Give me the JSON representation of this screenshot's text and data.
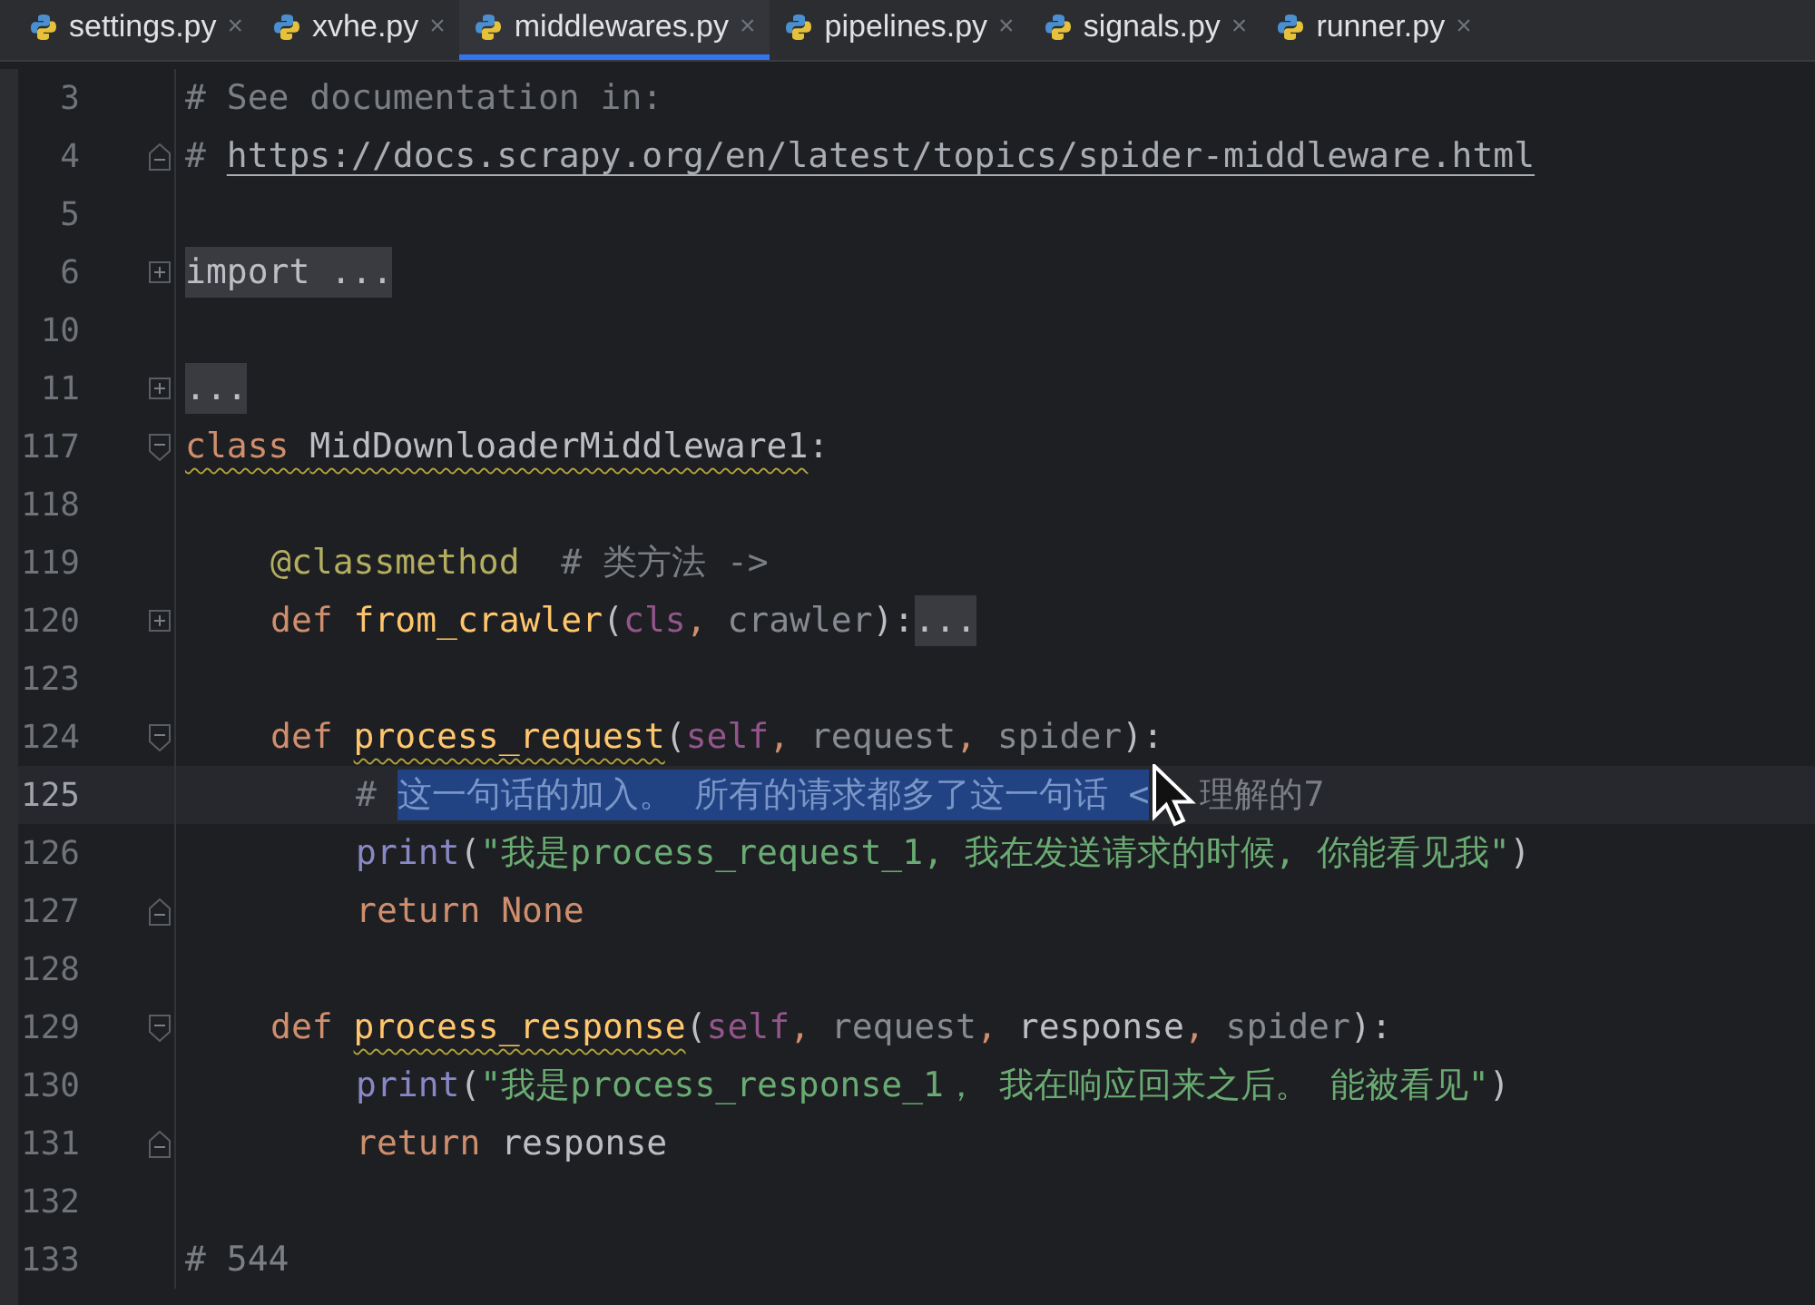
{
  "tabs": [
    {
      "label": "settings.py",
      "selected": false,
      "close": "×"
    },
    {
      "label": "xvhe.py",
      "selected": false,
      "close": "×"
    },
    {
      "label": "middlewares.py",
      "selected": true,
      "close": "×"
    },
    {
      "label": "pipelines.py",
      "selected": false,
      "close": "×"
    },
    {
      "label": "signals.py",
      "selected": false,
      "close": "×"
    },
    {
      "label": "runner.py",
      "selected": false,
      "close": "×"
    }
  ],
  "lines": [
    {
      "number": "3",
      "kind": "plain",
      "current": false,
      "tokens": [
        {
          "kind": "comment",
          "text": "# See documentation in:"
        }
      ]
    },
    {
      "number": "4",
      "kind": "end",
      "current": false,
      "tokens": [
        {
          "kind": "comment",
          "text": "# "
        },
        {
          "kind": "link",
          "text": "https://docs.scrapy.org/en/latest/topics/spider-middleware.html"
        }
      ]
    },
    {
      "number": "5",
      "kind": "plain",
      "current": false
    },
    {
      "number": "6",
      "kind": "expand",
      "current": false,
      "tokens": [
        {
          "kind": "folded",
          "text": "import ..."
        }
      ]
    },
    {
      "number": "10",
      "kind": "plain",
      "current": false
    },
    {
      "number": "11",
      "kind": "expand",
      "current": false,
      "tokens": [
        {
          "kind": "folded",
          "text": "..."
        }
      ]
    },
    {
      "number": "117",
      "kind": "collapse",
      "current": false,
      "tokens": [
        {
          "kind": "keyword",
          "text": "class ",
          "squiggle": true
        },
        {
          "kind": "plain",
          "text": "MidDownloaderMiddleware1",
          "squiggle": true
        },
        {
          "kind": "plain",
          "text": ":"
        }
      ],
      "children": [
        {
          "number": "118",
          "kind": "plain",
          "current": false
        },
        {
          "number": "119",
          "kind": "plain",
          "current": false,
          "tokens": [
            {
              "kind": "decorator",
              "text": "@classmethod"
            },
            {
              "kind": "comment",
              "text": "  # 类方法 ->"
            }
          ]
        },
        {
          "number": "120",
          "kind": "expand",
          "current": false,
          "tokens": [
            {
              "kind": "keyword",
              "text": "def "
            },
            {
              "kind": "function",
              "text": "from_crawler"
            },
            {
              "kind": "plain",
              "text": "("
            },
            {
              "kind": "self",
              "text": "cls"
            },
            {
              "kind": "keyword",
              "text": ", "
            },
            {
              "kind": "unused",
              "text": "crawler"
            },
            {
              "kind": "plain",
              "text": "):"
            },
            {
              "kind": "folded",
              "text": "..."
            }
          ]
        },
        {
          "number": "123",
          "kind": "plain",
          "current": false
        },
        {
          "number": "124",
          "kind": "collapse",
          "current": false,
          "tokens": [
            {
              "kind": "keyword",
              "text": "def "
            },
            {
              "kind": "function",
              "text": "process_request",
              "squiggle": true
            },
            {
              "kind": "plain",
              "text": "("
            },
            {
              "kind": "self",
              "text": "self"
            },
            {
              "kind": "keyword",
              "text": ", "
            },
            {
              "kind": "unused",
              "text": "request"
            },
            {
              "kind": "keyword",
              "text": ", "
            },
            {
              "kind": "unused",
              "text": "spider"
            },
            {
              "kind": "plain",
              "text": "):"
            }
          ],
          "children": [
            {
              "number": "125",
              "kind": "plain",
              "current": true,
              "tokens": [
                {
                  "kind": "comment",
                  "text": "# "
                },
                {
                  "kind": "selected",
                  "text": "这一句话的加入。 所有的请求都多了这一句话 <"
                },
                {
                  "kind": "comment",
                  "text": "理解的7"
                }
              ]
            },
            {
              "number": "126",
              "kind": "plain",
              "current": false,
              "tokens": [
                {
                  "kind": "builtin",
                  "text": "print"
                },
                {
                  "kind": "plain",
                  "text": "("
                },
                {
                  "kind": "string",
                  "text": "\"我是process_request_1, 我在发送请求的时候, 你能看见我\""
                },
                {
                  "kind": "plain",
                  "text": ")"
                }
              ]
            },
            {
              "number": "127",
              "kind": "end",
              "current": false,
              "tokens": [
                {
                  "kind": "keyword",
                  "text": "return None"
                }
              ]
            }
          ]
        },
        {
          "number": "128",
          "kind": "plain",
          "current": false
        },
        {
          "number": "129",
          "kind": "collapse",
          "current": false,
          "tokens": [
            {
              "kind": "keyword",
              "text": "def "
            },
            {
              "kind": "function",
              "text": "process_response",
              "squiggle": true
            },
            {
              "kind": "plain",
              "text": "("
            },
            {
              "kind": "self",
              "text": "self"
            },
            {
              "kind": "keyword",
              "text": ", "
            },
            {
              "kind": "unused",
              "text": "request"
            },
            {
              "kind": "keyword",
              "text": ", "
            },
            {
              "kind": "plain",
              "text": "response"
            },
            {
              "kind": "keyword",
              "text": ", "
            },
            {
              "kind": "unused",
              "text": "spider"
            },
            {
              "kind": "plain",
              "text": "):"
            }
          ],
          "children": [
            {
              "number": "130",
              "kind": "plain",
              "current": false,
              "tokens": [
                {
                  "kind": "builtin",
                  "text": "print"
                },
                {
                  "kind": "plain",
                  "text": "("
                },
                {
                  "kind": "string",
                  "text": "\"我是process_response_1， 我在响应回来之后。 能被看见\""
                },
                {
                  "kind": "plain",
                  "text": ")"
                }
              ]
            },
            {
              "number": "131",
              "kind": "end",
              "current": false,
              "tokens": [
                {
                  "kind": "keyword",
                  "text": "return "
                },
                {
                  "kind": "plain",
                  "text": "response"
                }
              ]
            }
          ]
        }
      ]
    },
    {
      "number": "132",
      "kind": "plain",
      "current": false
    },
    {
      "number": "133",
      "kind": "plain",
      "current": false,
      "tokens": [
        {
          "kind": "comment",
          "text": "# 544"
        }
      ]
    }
  ]
}
